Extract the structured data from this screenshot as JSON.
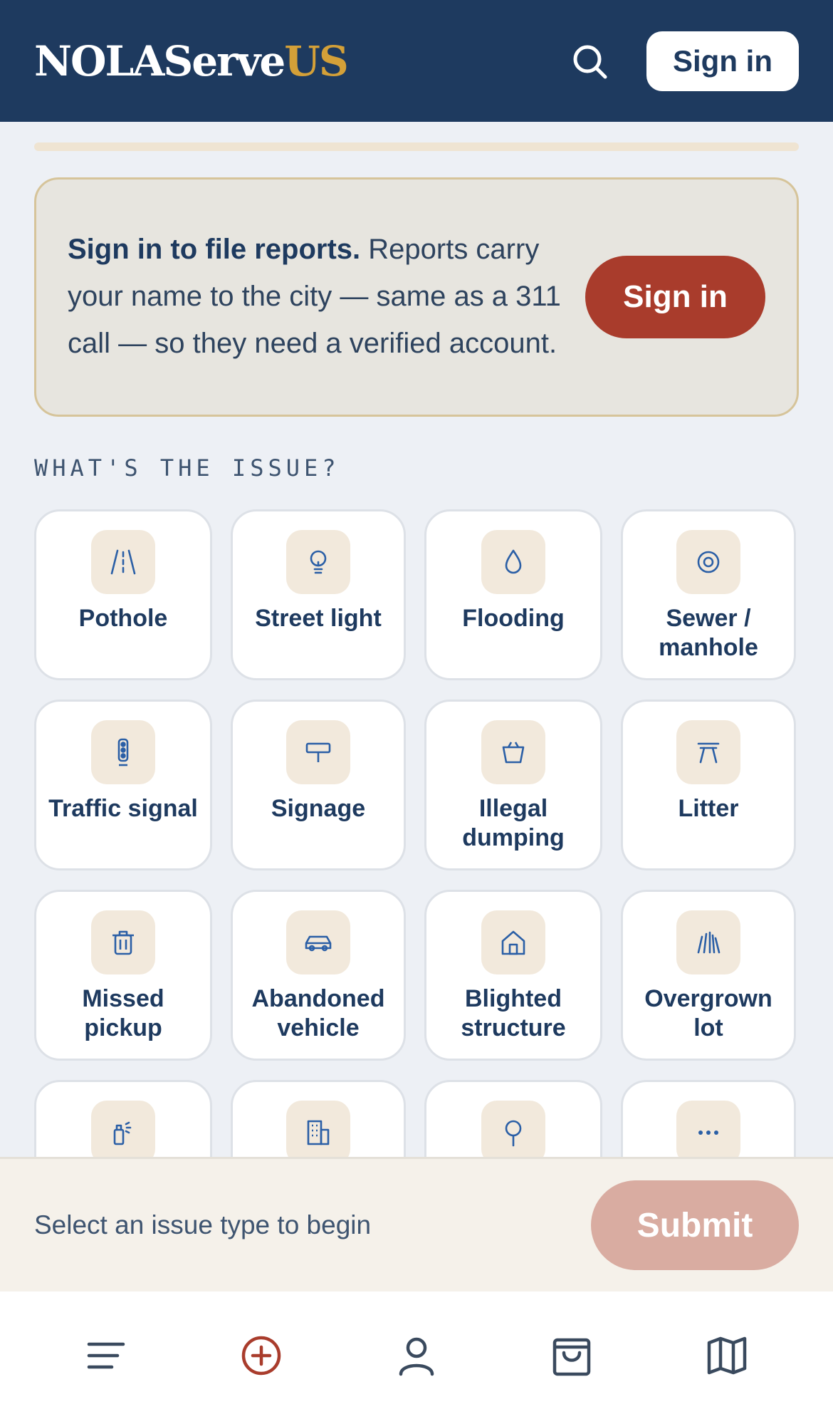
{
  "header": {
    "logo_main": "NOLAServe",
    "logo_accent": "US",
    "signin_label": "Sign in"
  },
  "notice": {
    "bold": "Sign in to file reports.",
    "text": " Reports carry your name to the city — same as a 311 call — so they need a verified account.",
    "button_label": "Sign in"
  },
  "section_label": "WHAT'S THE ISSUE?",
  "issues": [
    {
      "label": "Pothole",
      "icon": "pothole-icon"
    },
    {
      "label": "Street light",
      "icon": "lightbulb-icon"
    },
    {
      "label": "Flooding",
      "icon": "water-drop-icon"
    },
    {
      "label": "Sewer / manhole",
      "icon": "manhole-icon"
    },
    {
      "label": "Traffic signal",
      "icon": "traffic-light-icon"
    },
    {
      "label": "Signage",
      "icon": "sign-icon"
    },
    {
      "label": "Illegal dumping",
      "icon": "bag-icon"
    },
    {
      "label": "Litter",
      "icon": "litter-icon"
    },
    {
      "label": "Missed pickup",
      "icon": "trash-can-icon"
    },
    {
      "label": "Abandoned vehicle",
      "icon": "car-icon"
    },
    {
      "label": "Blighted structure",
      "icon": "house-icon"
    },
    {
      "label": "Overgrown lot",
      "icon": "grass-icon"
    },
    {
      "label": "",
      "icon": "spray-can-icon"
    },
    {
      "label": "",
      "icon": "building-icon"
    },
    {
      "label": "",
      "icon": "tree-icon"
    },
    {
      "label": "",
      "icon": "more-icon"
    }
  ],
  "action_bar": {
    "hint": "Select an issue type to begin",
    "submit_label": "Submit"
  },
  "colors": {
    "navy": "#1e3a5f",
    "gold": "#d4a038",
    "brick": "#a93c2c",
    "submit_disabled": "#d9aca1"
  }
}
